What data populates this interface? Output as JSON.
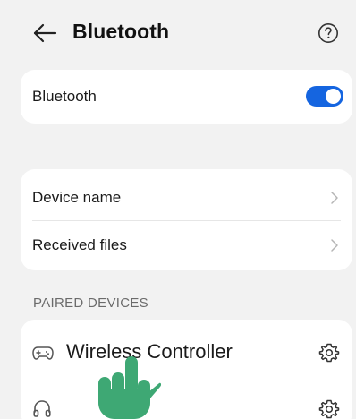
{
  "header": {
    "title": "Bluetooth",
    "back_icon": "arrow-left-icon",
    "help_icon": "question-circle-icon"
  },
  "bluetooth": {
    "label": "Bluetooth",
    "enabled": true,
    "toggle_color": "#1565e0"
  },
  "device_settings": {
    "items": [
      {
        "label": "Device name",
        "icon": "chevron-right-icon"
      },
      {
        "label": "Received files",
        "icon": "chevron-right-icon"
      }
    ]
  },
  "paired": {
    "section_title": "PAIRED DEVICES",
    "devices": [
      {
        "name": "Wireless Controller",
        "icon": "gamepad-icon",
        "settings_icon": "gear-icon"
      },
      {
        "name": "",
        "icon": "headphones-icon",
        "settings_icon": "gear-icon"
      }
    ]
  },
  "overlay": {
    "cursor_icon": "hand-pointer-icon",
    "cursor_color": "#3ea874"
  }
}
